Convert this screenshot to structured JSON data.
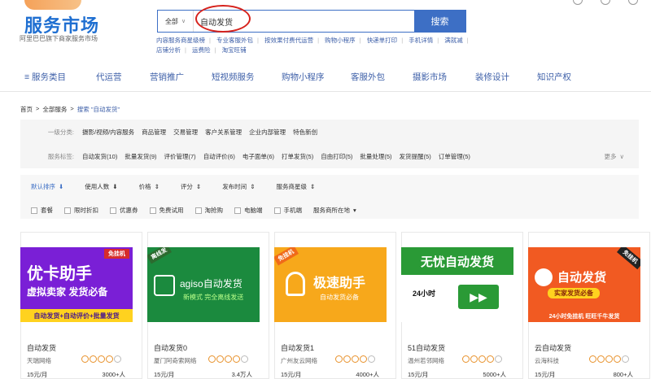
{
  "header": {
    "logo_text": "服务市场",
    "logo_sub": "阿里巴巴旗下商家服务市场",
    "search_scope": "全部",
    "search_value": "自动发货",
    "search_button": "搜索",
    "hot_links": [
      "内容服务商星级榜",
      "专业客服外包",
      "按效果付费代运营",
      "购物小程序",
      "快递单打印",
      "手机详情",
      "满就减",
      "店铺分析",
      "运费险",
      "淘宝旺铺"
    ]
  },
  "nav": {
    "items": [
      "服务类目",
      "代运营",
      "营销推广",
      "短视频服务",
      "购物小程序",
      "客服外包",
      "摄影市场",
      "装修设计",
      "知识产权"
    ]
  },
  "breadcrumb": {
    "home": "首页",
    "all": "全部服务",
    "current": "搜索 \"自动发货\""
  },
  "filters": {
    "category_label": "一级分类:",
    "categories": [
      "摄影/视频/内容服务",
      "商品管理",
      "交易管理",
      "客户关系管理",
      "企业内部管理",
      "特色新创"
    ],
    "tag_label": "服务标签:",
    "tags": [
      "自动发货(10)",
      "批量发货(9)",
      "评价管理(7)",
      "自动评价(6)",
      "电子面单(6)",
      "打单发货(5)",
      "自由打印(5)",
      "批量处理(5)",
      "发货提醒(5)",
      "订单管理(5)"
    ],
    "more": "更多"
  },
  "sort": {
    "options": [
      "默认排序",
      "使用人数",
      "价格",
      "评分",
      "发布时间",
      "服务商星级"
    ],
    "active": "默认排序",
    "checks": [
      "套餐",
      "限时折扣",
      "优惠券",
      "免费试用",
      "淘抢购",
      "电脑端",
      "手机端"
    ],
    "location": "服务商所在地"
  },
  "cards": [
    {
      "title": "自动发货",
      "vendor": "天瑞网络",
      "price": "15元/月",
      "users": "3000+人",
      "stars": 4,
      "banner_top": "优卡助手",
      "banner_sub": "虚拟卖家 发货必备",
      "banner_foot": "自动发货+自动评价+批量发货",
      "ribbon": "免挂机",
      "color": "#7a1fd6"
    },
    {
      "title": "自动发货0",
      "vendor": "厦门阿奇索网络",
      "price": "15元/月",
      "users": "3.4万人",
      "stars": 4,
      "banner_top": "agiso自动发货",
      "banner_sub": "新模式 完全离线发送",
      "ribbon": "离线发",
      "color": "#1b8a3e"
    },
    {
      "title": "自动发货1",
      "vendor": "广州友云网络",
      "price": "15元/月",
      "users": "4000+人",
      "stars": 4,
      "banner_top": "极速助手",
      "banner_sub": "自动发货必备",
      "ribbon": "免挂机",
      "color": "#f7a81b"
    },
    {
      "title": "51自动发货",
      "vendor": "温州若邻网络",
      "price": "15元/月",
      "users": "5000+人",
      "stars": 4,
      "banner_top": "无忧自动发货",
      "banner_sub": "24小时",
      "color": "#2a9a36"
    },
    {
      "title": "云自动发货",
      "vendor": "云海科技",
      "price": "15元/月",
      "users": "800+人",
      "stars": 4,
      "banner_top": "自动发货",
      "banner_sub": "实家发货必备",
      "banner_foot": "24小时免挂机 旺旺千牛发货",
      "ribbon": "免挂机",
      "color": "#f15a22"
    }
  ]
}
